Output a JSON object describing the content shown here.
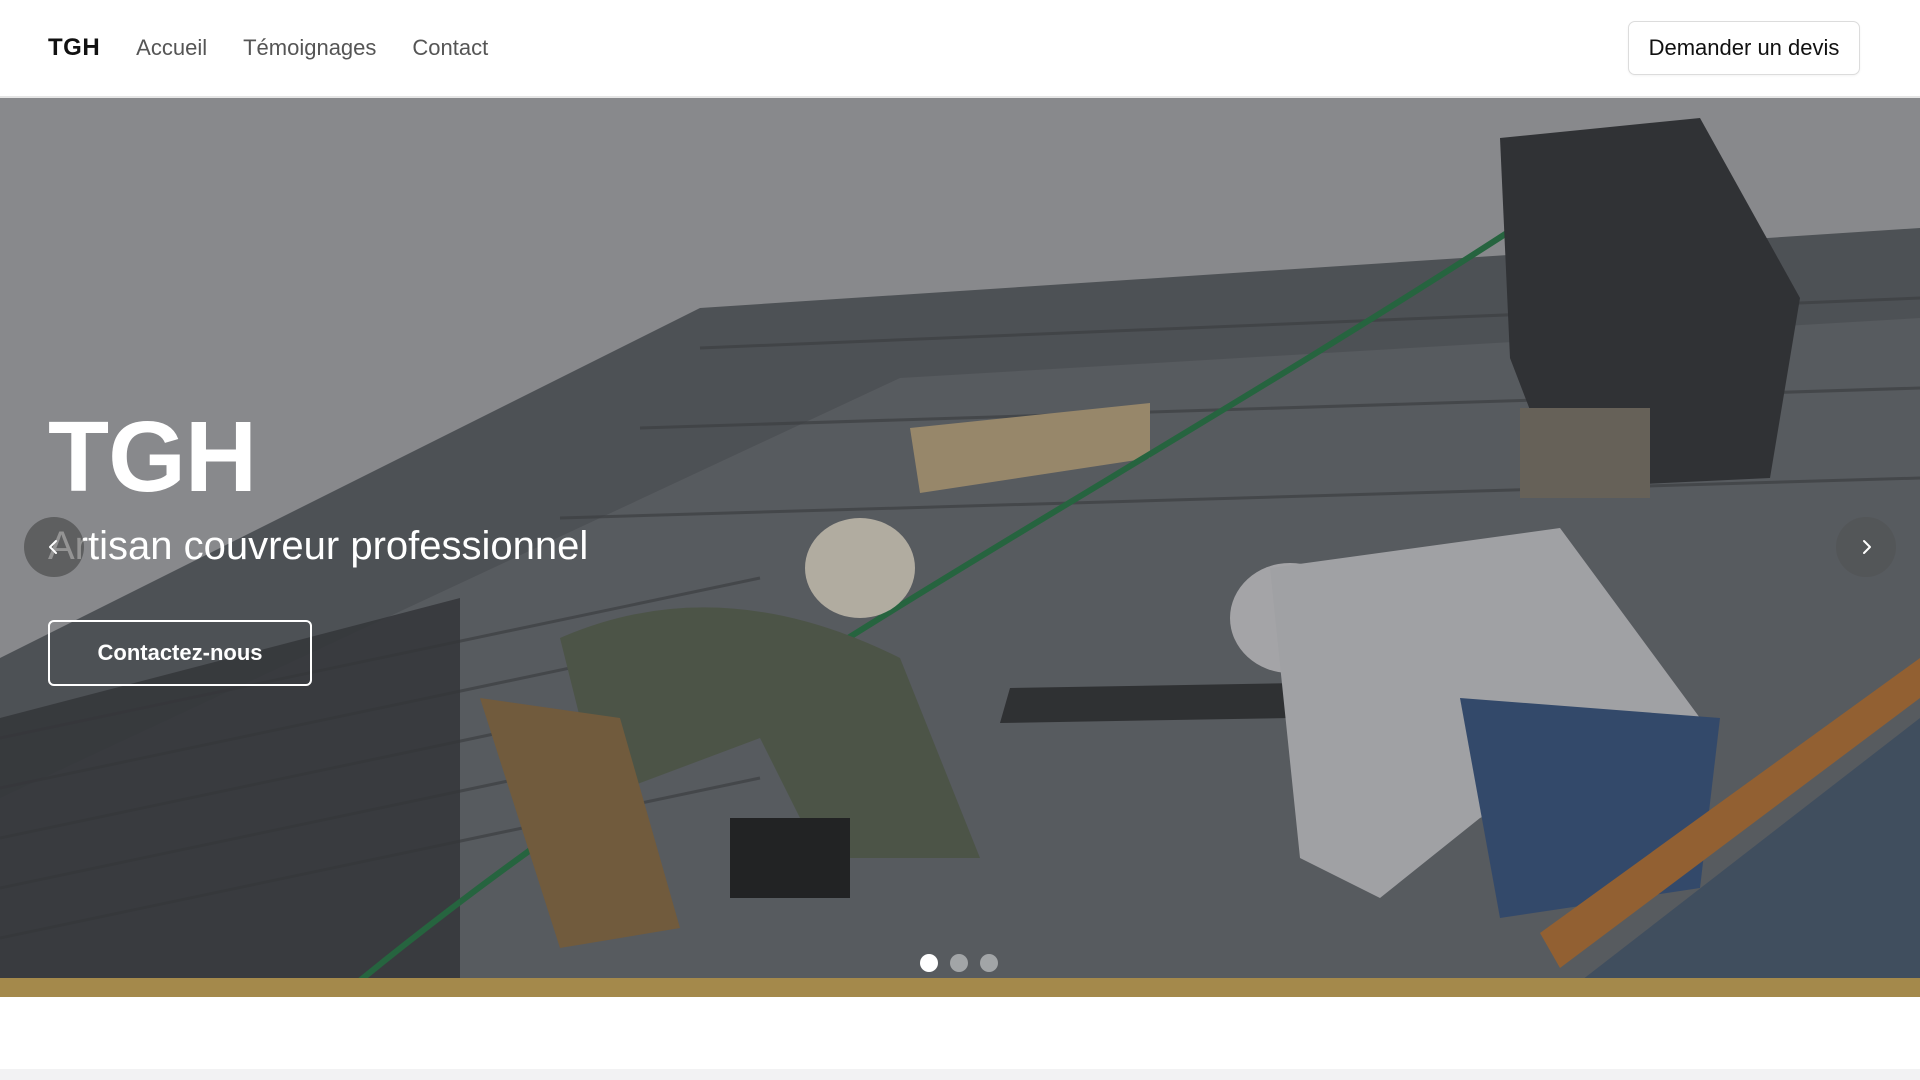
{
  "header": {
    "brand": "TGH",
    "nav": [
      {
        "label": "Accueil"
      },
      {
        "label": "Témoignages"
      },
      {
        "label": "Contact"
      }
    ],
    "cta_label": "Demander un devis"
  },
  "hero": {
    "title": "TGH",
    "subtitle": "Artisan couvreur professionnel",
    "cta_label": "Contactez-nous",
    "prev_icon": "chevron-left-icon",
    "next_icon": "chevron-right-icon",
    "slides_count": 3,
    "active_slide": 1
  },
  "colors": {
    "text": "#111111",
    "nav_text": "#555555",
    "overlay": "rgba(0,0,0,0.18)"
  }
}
